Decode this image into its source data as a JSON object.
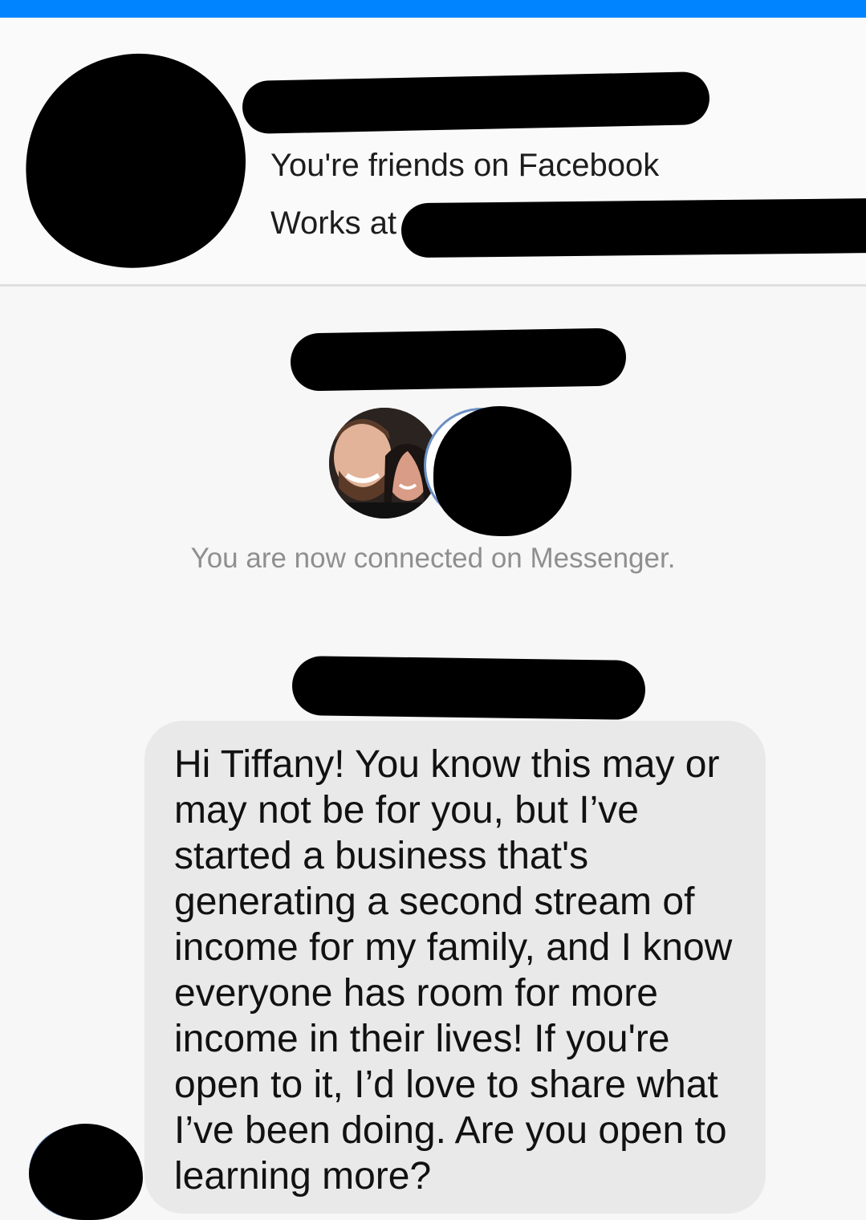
{
  "header": {
    "name": "",
    "friends_line": "You're friends on Facebook",
    "works_label": "Works at"
  },
  "thread": {
    "connected_notice": "You are now connected on Messenger."
  },
  "messages": [
    {
      "text": "Hi Tiffany! You know this may or may not be for you, but I’ve started a business that's generating a second stream of income for my family, and I know everyone has room for more income in their lives! If you're open to it, I’d love to share what I’ve been doing. Are you open to learning more?"
    }
  ],
  "colors": {
    "top_bar": "#0084ff",
    "page_background": "#f7f7f7",
    "bubble_background": "#e9e9e9",
    "notice_text": "#8f8f8f"
  }
}
